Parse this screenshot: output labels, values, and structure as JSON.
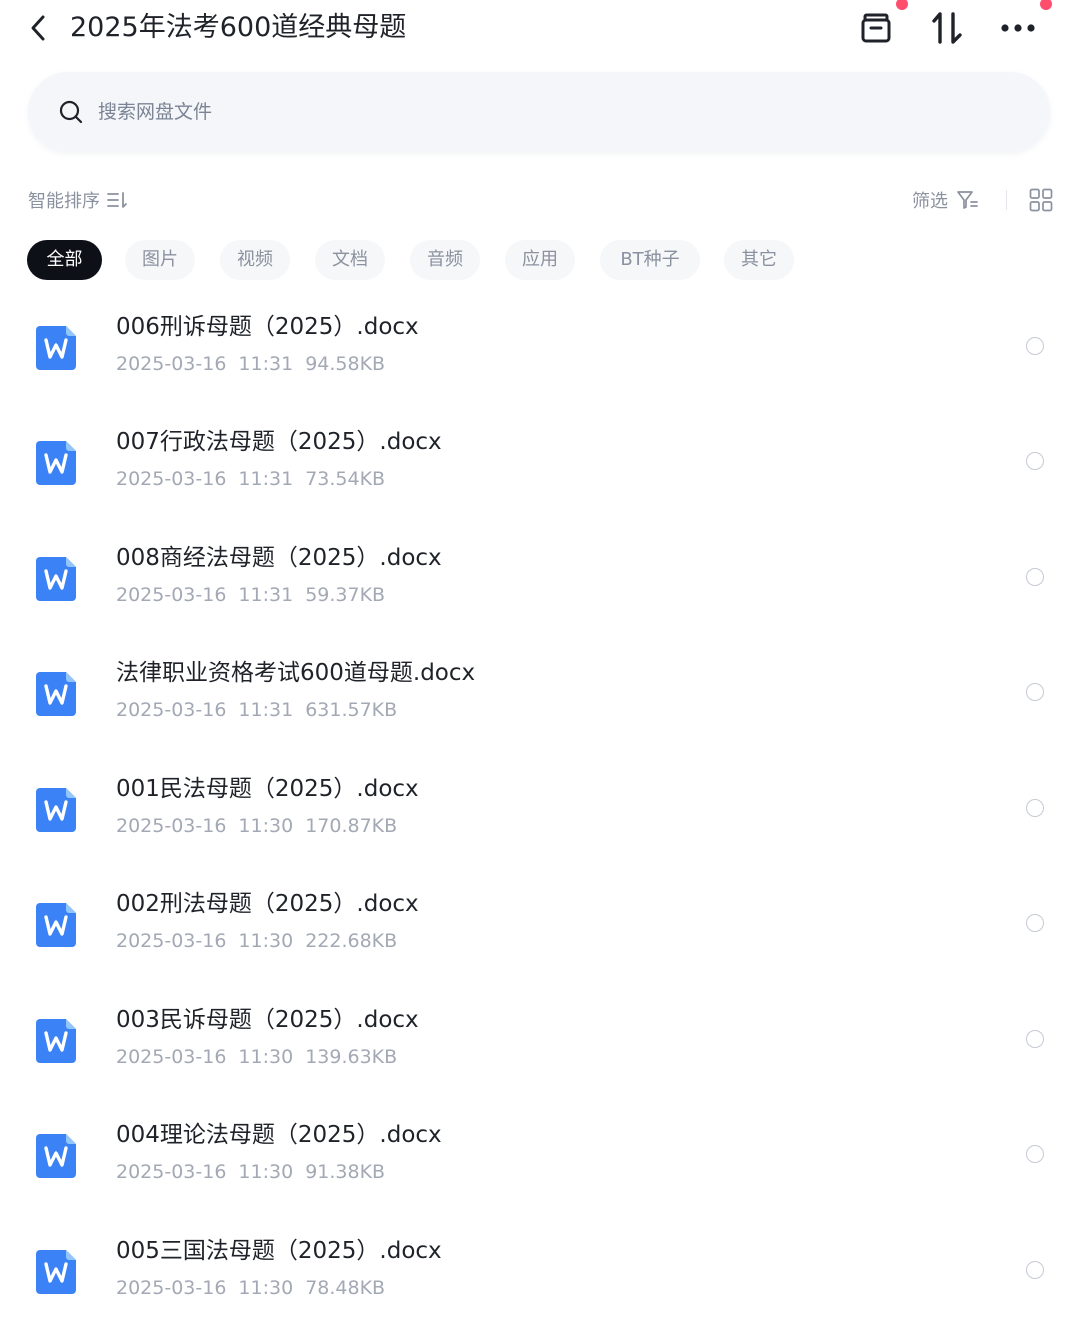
{
  "header": {
    "title": "2025年法考600道经典母题",
    "back_icon": "chevron-left-icon",
    "archive_icon": "archive-box-icon",
    "sort_icon": "sort-arrows-icon",
    "more_icon": "more-dots-icon",
    "badge_color": "#ff4d6d"
  },
  "search": {
    "placeholder": "搜索网盘文件"
  },
  "toolbar": {
    "sort_label": "智能排序",
    "filter_label": "筛选"
  },
  "tabs": [
    {
      "label": "全部",
      "active": true
    },
    {
      "label": "图片",
      "active": false
    },
    {
      "label": "视频",
      "active": false
    },
    {
      "label": "文档",
      "active": false
    },
    {
      "label": "音频",
      "active": false
    },
    {
      "label": "应用",
      "active": false
    },
    {
      "label": "BT种子",
      "active": false
    },
    {
      "label": "其它",
      "active": false
    }
  ],
  "files": [
    {
      "name": "006刑诉母题（2025）.docx",
      "date": "2025-03-16",
      "time": "11:31",
      "size": "94.58KB",
      "type": "word"
    },
    {
      "name": "007行政法母题（2025）.docx",
      "date": "2025-03-16",
      "time": "11:31",
      "size": "73.54KB",
      "type": "word"
    },
    {
      "name": "008商经法母题（2025）.docx",
      "date": "2025-03-16",
      "time": "11:31",
      "size": "59.37KB",
      "type": "word"
    },
    {
      "name": "法律职业资格考试600道母题.docx",
      "date": "2025-03-16",
      "time": "11:31",
      "size": "631.57KB",
      "type": "word"
    },
    {
      "name": "001民法母题（2025）.docx",
      "date": "2025-03-16",
      "time": "11:30",
      "size": "170.87KB",
      "type": "word"
    },
    {
      "name": "002刑法母题（2025）.docx",
      "date": "2025-03-16",
      "time": "11:30",
      "size": "222.68KB",
      "type": "word"
    },
    {
      "name": "003民诉母题（2025）.docx",
      "date": "2025-03-16",
      "time": "11:30",
      "size": "139.63KB",
      "type": "word"
    },
    {
      "name": "004理论法母题（2025）.docx",
      "date": "2025-03-16",
      "time": "11:30",
      "size": "91.38KB",
      "type": "word"
    },
    {
      "name": "005三国法母题（2025）.docx",
      "date": "2025-03-16",
      "time": "11:30",
      "size": "78.48KB",
      "type": "word"
    }
  ],
  "colors": {
    "word_icon": "#3b82f6",
    "active_tab": "#0d1117"
  }
}
